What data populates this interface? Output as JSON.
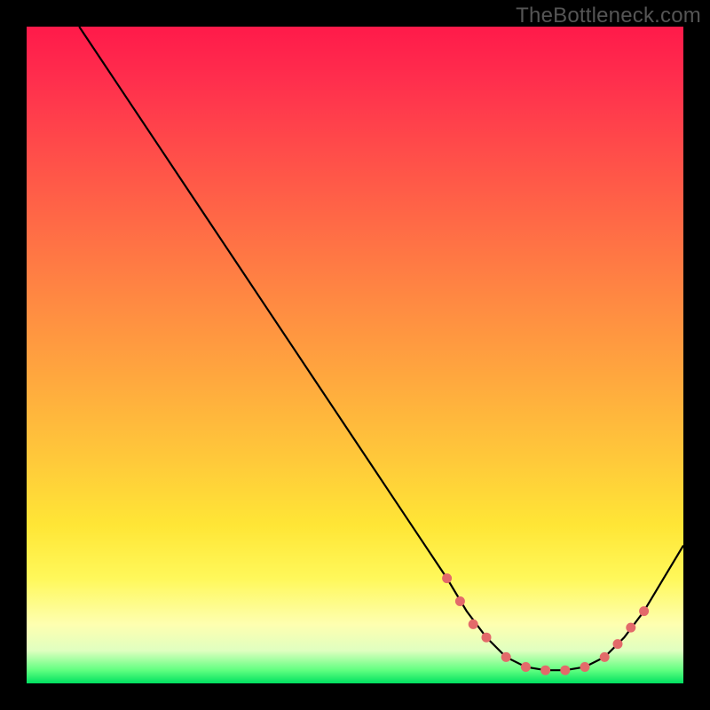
{
  "watermark": "TheBottleneck.com",
  "chart_data": {
    "type": "line",
    "title": "",
    "xlabel": "",
    "ylabel": "",
    "xlim": [
      0,
      100
    ],
    "ylim": [
      0,
      100
    ],
    "grid": false,
    "legend": false,
    "series": [
      {
        "name": "bottleneck-curve",
        "color": "#000000",
        "x": [
          8,
          12,
          16,
          20,
          24,
          28,
          32,
          36,
          40,
          44,
          48,
          52,
          56,
          60,
          64,
          67,
          70,
          73,
          76,
          79,
          82,
          85,
          88,
          91,
          94,
          97,
          100
        ],
        "y": [
          100,
          94,
          88,
          82,
          76,
          70,
          64,
          58,
          52,
          46,
          40,
          34,
          28,
          22,
          16,
          11,
          7,
          4,
          2.5,
          2,
          2,
          2.5,
          4,
          7,
          11,
          16,
          21
        ]
      }
    ],
    "markers": {
      "name": "optimal-range-dots",
      "color": "#e36a6a",
      "radius": 5.5,
      "points": [
        {
          "x": 64,
          "y": 16
        },
        {
          "x": 66,
          "y": 12.5
        },
        {
          "x": 68,
          "y": 9
        },
        {
          "x": 70,
          "y": 7
        },
        {
          "x": 73,
          "y": 4
        },
        {
          "x": 76,
          "y": 2.5
        },
        {
          "x": 79,
          "y": 2
        },
        {
          "x": 82,
          "y": 2
        },
        {
          "x": 85,
          "y": 2.5
        },
        {
          "x": 88,
          "y": 4
        },
        {
          "x": 90,
          "y": 6
        },
        {
          "x": 92,
          "y": 8.5
        },
        {
          "x": 94,
          "y": 11
        }
      ]
    },
    "background_gradient": {
      "top": "#ff1a4a",
      "mid": "#ffe636",
      "bottom": "#00e060"
    }
  }
}
